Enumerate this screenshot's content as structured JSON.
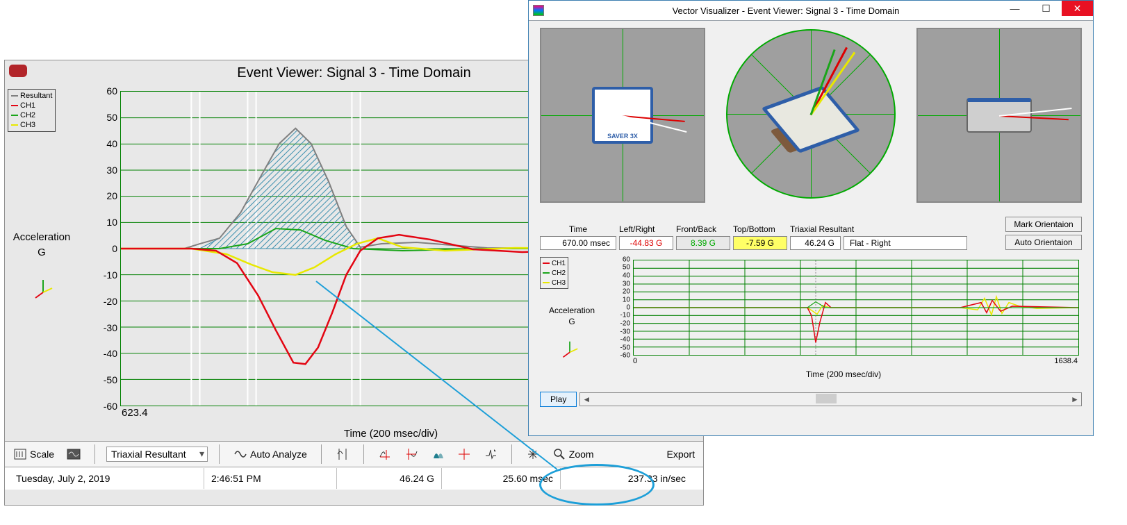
{
  "event_viewer": {
    "title": "Event Viewer: Signal  3  - Time Domain",
    "legend": {
      "resultant": "Resultant",
      "ch1": "CH1",
      "ch2": "CH2",
      "ch3": "CH3"
    },
    "y_label": "Acceleration",
    "y_sub": "G",
    "x_label": "Time (200 msec/div)",
    "x_start": "623.4",
    "y_ticks": [
      "60",
      "50",
      "40",
      "30",
      "20",
      "10",
      "0",
      "-10",
      "-20",
      "-30",
      "-40",
      "-50",
      "-60"
    ],
    "toolbar": {
      "scale": "Scale",
      "combo": "Triaxial Resultant",
      "auto": "Auto Analyze",
      "zoom": "Zoom",
      "export": "Export"
    },
    "status": {
      "date": "Tuesday, July 2, 2019",
      "time": "2:46:51 PM",
      "peak": "46.24 G",
      "dur": "25.60 msec",
      "vel": "237.33 in/sec"
    }
  },
  "vector_visualizer": {
    "title": "Vector Visualizer - Event Viewer: Signal  3  - Time Domain",
    "sensor_label": "SAVER 3X",
    "readouts": {
      "time_lbl": "Time",
      "time_val": "670.00 msec",
      "lr_lbl": "Left/Right",
      "lr_val": "-44.83 G",
      "fb_lbl": "Front/Back",
      "fb_val": "8.39 G",
      "tb_lbl": "Top/Bottom",
      "tb_val": "-7.59 G",
      "tr_lbl": "Triaxial Resultant",
      "tr_val": "46.24 G",
      "orient": "Flat - Right"
    },
    "buttons": {
      "mark": "Mark Orientaion",
      "auto": "Auto Orientaion"
    },
    "mini": {
      "legend": {
        "ch1": "CH1",
        "ch2": "CH2",
        "ch3": "CH3"
      },
      "y_label": "Acceleration",
      "y_sub": "G",
      "y_ticks": [
        "60",
        "50",
        "40",
        "30",
        "20",
        "10",
        "0",
        "-10",
        "-20",
        "-30",
        "-40",
        "-50",
        "-60"
      ],
      "x_start": "0",
      "x_end": "1638.4",
      "x_label": "Time (200 msec/div)"
    },
    "play": "Play"
  },
  "colors": {
    "ch1": "#E30613",
    "ch2": "#1AA51A",
    "ch3": "#E8E800",
    "resultant": "#808080",
    "grid": "#008000"
  },
  "chart_data": [
    {
      "type": "line",
      "title": "Event Viewer: Signal 3 - Time Domain",
      "xlabel": "Time (200 msec/div)",
      "ylabel": "Acceleration G",
      "xlim": [
        623.4,
        823.4
      ],
      "ylim": [
        -60,
        60
      ],
      "highlight_region_x": [
        645,
        735
      ],
      "integral_shaded": "Resultant",
      "series": [
        {
          "name": "Resultant",
          "color": "#808080",
          "x": [
            623,
            640,
            648,
            660,
            668,
            676,
            684,
            692,
            700,
            710,
            720,
            735,
            760,
            800,
            823
          ],
          "y": [
            0,
            0,
            2,
            10,
            25,
            40,
            46,
            40,
            25,
            10,
            3,
            0,
            2,
            0,
            0
          ]
        },
        {
          "name": "CH1",
          "color": "#E30613",
          "x": [
            623,
            640,
            652,
            660,
            668,
            676,
            684,
            692,
            698,
            706,
            714,
            725,
            740,
            760,
            790,
            823
          ],
          "y": [
            0,
            0,
            0,
            -5,
            -18,
            -35,
            -44,
            -38,
            -22,
            -8,
            0,
            4,
            5,
            3,
            -1,
            0
          ]
        },
        {
          "name": "CH2",
          "color": "#1AA51A",
          "x": [
            623,
            650,
            668,
            680,
            692,
            704,
            720,
            740,
            780,
            823
          ],
          "y": [
            0,
            0,
            2,
            8,
            7,
            3,
            0,
            -1,
            0,
            0
          ]
        },
        {
          "name": "CH3",
          "color": "#E8E800",
          "x": [
            623,
            640,
            656,
            666,
            676,
            684,
            692,
            702,
            714,
            728,
            750,
            790,
            823
          ],
          "y": [
            0,
            0,
            -2,
            -6,
            -9,
            -10,
            -7,
            -2,
            2,
            4,
            0,
            -1,
            0
          ]
        }
      ]
    },
    {
      "type": "line",
      "title": "Vector Visualizer mini plot",
      "xlabel": "Time (200 msec/div)",
      "ylabel": "Acceleration G",
      "xlim": [
        0,
        1638.4
      ],
      "ylim": [
        -60,
        60
      ],
      "cursor_x": 670,
      "series": [
        {
          "name": "CH1",
          "color": "#E30613",
          "x": [
            0,
            200,
            640,
            655,
            670,
            685,
            700,
            720,
            800,
            1200,
            1280,
            1300,
            1320,
            1350,
            1400,
            1500,
            1638
          ],
          "y": [
            0,
            0,
            0,
            -10,
            -45,
            -20,
            5,
            0,
            0,
            0,
            5,
            -6,
            8,
            -4,
            2,
            0,
            0
          ]
        },
        {
          "name": "CH2",
          "color": "#1AA51A",
          "x": [
            0,
            640,
            670,
            700,
            1638
          ],
          "y": [
            0,
            0,
            8,
            0,
            0
          ]
        },
        {
          "name": "CH3",
          "color": "#E8E800",
          "x": [
            0,
            200,
            640,
            660,
            680,
            700,
            740,
            1200,
            1260,
            1290,
            1310,
            1340,
            1370,
            1420,
            1500,
            1638
          ],
          "y": [
            0,
            0,
            0,
            -4,
            -8,
            2,
            0,
            0,
            -3,
            10,
            -8,
            12,
            -6,
            4,
            -1,
            0
          ]
        }
      ]
    }
  ]
}
